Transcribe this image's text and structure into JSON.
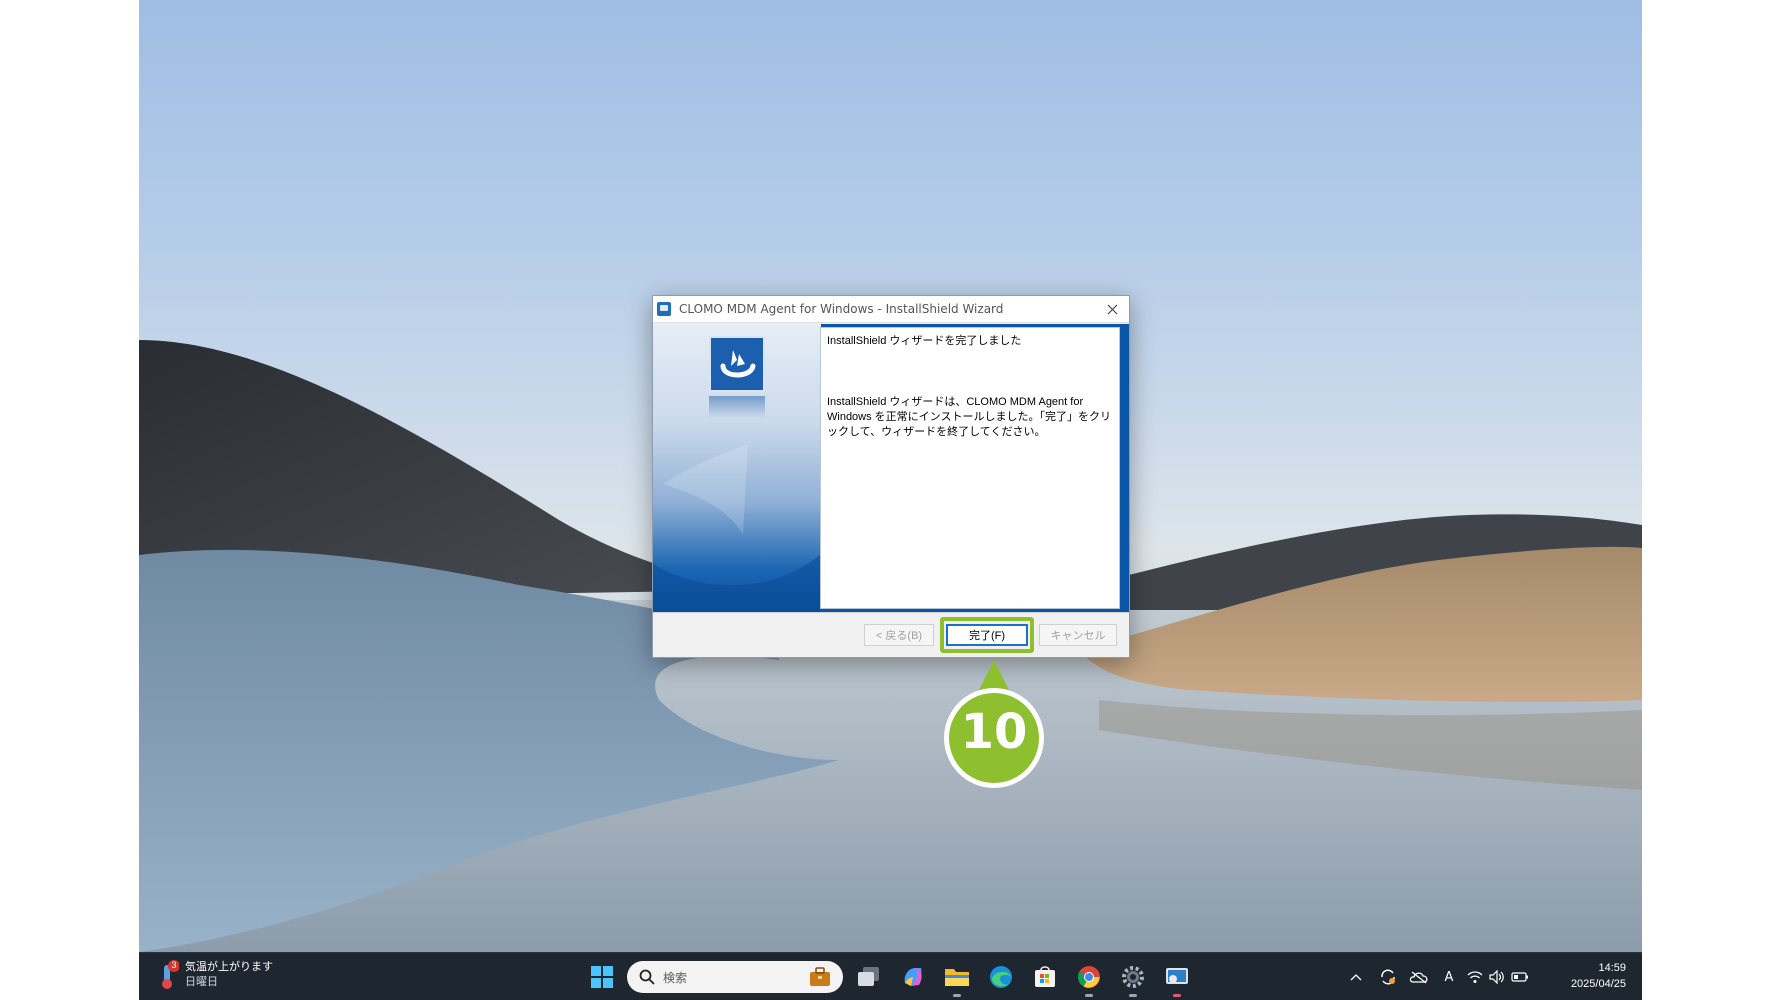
{
  "dialog": {
    "title": "CLOMO MDM Agent for Windows - InstallShield Wizard",
    "heading": "InstallShield ウィザードを完了しました",
    "message": "InstallShield ウィザードは、CLOMO MDM Agent for Windows を正常にインストールしました。「完了」をクリックして、ウィザードを終了してください。",
    "buttons": {
      "back": "< 戻る(B)",
      "finish": "完了(F)",
      "cancel": "キャンセル"
    }
  },
  "callout": {
    "step": "10",
    "color": "#8dbf2e"
  },
  "taskbar": {
    "weather": {
      "badge": "3",
      "line1": "気温が上がります",
      "line2": "日曜日"
    },
    "search_placeholder": "検索",
    "apps": [
      "start-icon",
      "search-icon",
      "work-briefcase-icon",
      "task-view-icon",
      "copilot-icon",
      "file-explorer-icon",
      "edge-icon",
      "microsoft-store-icon",
      "chrome-icon",
      "settings-icon",
      "installer-app-icon"
    ],
    "tray": {
      "ime": "A"
    },
    "clock": {
      "time": "14:59",
      "date": "2025/04/25"
    }
  }
}
